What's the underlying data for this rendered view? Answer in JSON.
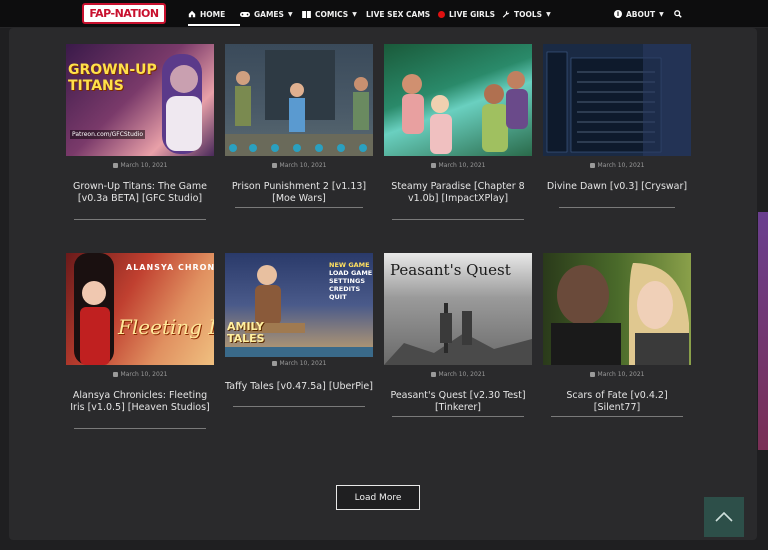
{
  "header": {
    "logo_text": "FAP-NATION",
    "nav": [
      {
        "label": "HOME",
        "icon": "home-icon",
        "active": true
      },
      {
        "label": "GAMES",
        "icon": "gamepad-icon",
        "caret": true
      },
      {
        "label": "COMICS",
        "icon": "book-icon",
        "caret": true
      },
      {
        "label": "LIVE SEX CAMS",
        "icon": "",
        "caret": false
      },
      {
        "label": "LIVE GIRLS",
        "icon": "red-dot-icon",
        "caret": false
      },
      {
        "label": "TOOLS",
        "icon": "wrench-icon",
        "caret": true
      },
      {
        "label": "ABOUT",
        "icon": "info-icon",
        "caret": true
      }
    ]
  },
  "posts": [
    {
      "title": "Grown-Up Titans: The Game [v0.3a BETA] [GFC Studio]",
      "date": "March 10, 2021",
      "thumb_text": "GROWN-UP TITANS",
      "thumb_sub": "Patreon.com/GFCStudio"
    },
    {
      "title": "Prison Punishment 2 [v1.13] [Moe Wars]",
      "date": "March 10, 2021"
    },
    {
      "title": "Steamy Paradise [Chapter 8 v1.0b] [ImpactXPlay]",
      "date": "March 10, 2021"
    },
    {
      "title": "Divine Dawn [v0.3] [Cryswar]",
      "date": "March 10, 2021"
    },
    {
      "title": "Alansya Chronicles: Fleeting Iris [v1.0.5] [Heaven Studios]",
      "date": "March 10, 2021",
      "thumb_text": "Fleeting Iris",
      "thumb_sub": "ALANSYA CHRONICLES"
    },
    {
      "title": "Taffy Tales [v0.47.5a] [UberPie]",
      "date": "March 10, 2021",
      "menu": [
        "NEW GAME",
        "LOAD GAME",
        "SETTINGS",
        "CREDITS",
        "QUIT"
      ],
      "thumb_text": "AMILY TALES"
    },
    {
      "title": "Peasant's Quest [v2.30 Test] [Tinkerer]",
      "date": "March 10, 2021",
      "thumb_text": "Peasant's Quest"
    },
    {
      "title": "Scars of Fate [v0.4.2] [Silent77]",
      "date": "March 10, 2021"
    }
  ],
  "load_more_label": "Load More",
  "colors": {
    "bg": "#1f1f21",
    "panel": "#2a2a2c",
    "accent_red": "#c8102e",
    "scroll_top": "#2d4f49"
  }
}
